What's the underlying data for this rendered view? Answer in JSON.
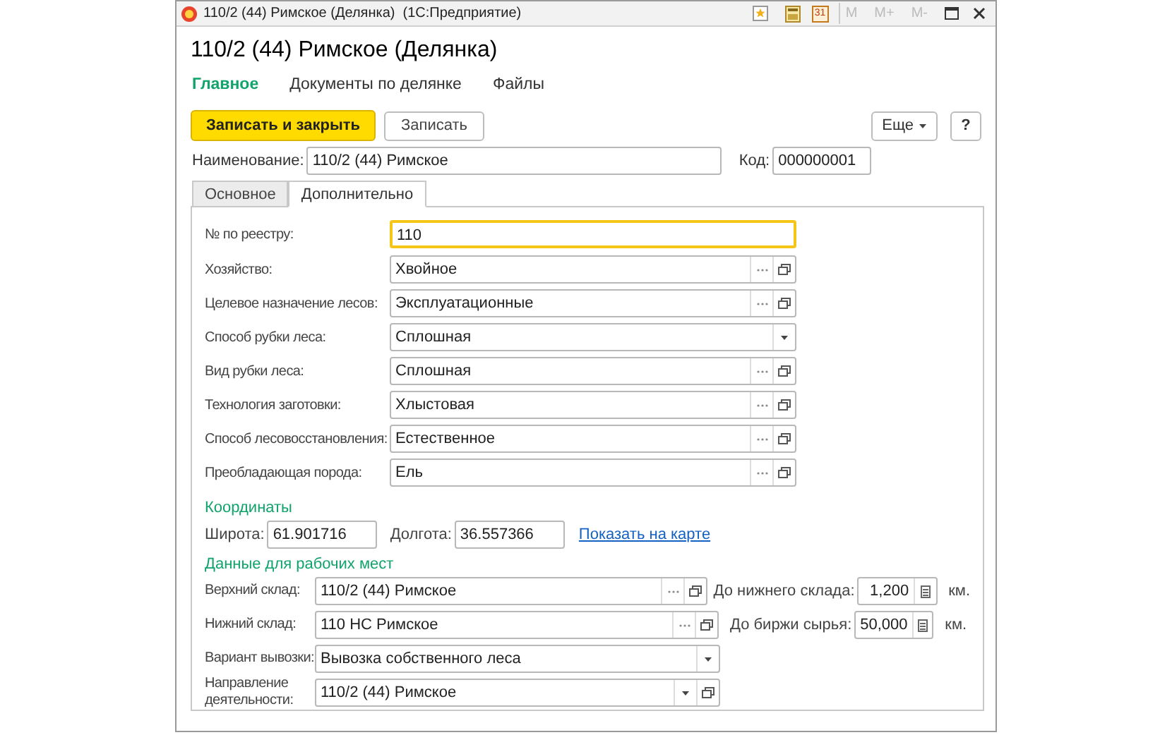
{
  "window": {
    "title": "110/2 (44) Римское (Делянка)  (1С:Предприятие)",
    "calendar_day": "31",
    "memory_buttons": [
      "M",
      "M+",
      "M-"
    ]
  },
  "header": {
    "title": "110/2 (44) Римское (Делянка)"
  },
  "nav": [
    {
      "label": "Главное",
      "selected": true
    },
    {
      "label": "Документы по делянке",
      "selected": false
    },
    {
      "label": "Файлы",
      "selected": false
    }
  ],
  "commands": {
    "primary": "Записать и закрыть",
    "secondary": "Записать",
    "more": "Еще",
    "help": "?"
  },
  "name_field": {
    "label": "Наименование:",
    "value": "110/2 (44) Римское"
  },
  "code_field": {
    "label": "Код:",
    "value": "000000001"
  },
  "tabs": [
    {
      "label": "Основное",
      "selected": false
    },
    {
      "label": "Дополнительно",
      "selected": true
    }
  ],
  "fields": [
    {
      "label": "№ по реестру:",
      "value": "110",
      "kind": "text",
      "focused": true
    },
    {
      "label": "Хозяйство:",
      "value": "Хвойное",
      "kind": "select",
      "focused": false
    },
    {
      "label": "Целевое назначение лесов:",
      "value": "Эксплуатационные",
      "kind": "select",
      "focused": false
    },
    {
      "label": "Способ рубки леса:",
      "value": "Сплошная",
      "kind": "dropdown",
      "focused": false
    },
    {
      "label": "Вид рубки леса:",
      "value": "Сплошная",
      "kind": "select",
      "focused": false
    },
    {
      "label": "Технология заготовки:",
      "value": "Хлыстовая",
      "kind": "select",
      "focused": false
    },
    {
      "label": "Способ лесовосстановления:",
      "value": "Естественное",
      "kind": "select",
      "focused": false
    },
    {
      "label": "Преобладающая порода:",
      "value": "Ель",
      "kind": "select",
      "focused": false
    }
  ],
  "coordinates": {
    "heading": "Координаты",
    "latitude": {
      "label": "Широта:",
      "value": "61.901716"
    },
    "longitude": {
      "label": "Долгота:",
      "value": "36.557366"
    },
    "map_link": "Показать на карте"
  },
  "workplace": {
    "heading": "Данные для рабочих мест",
    "fields": [
      {
        "label": "Верхний склад:",
        "value": "110/2 (44) Римское",
        "kind": "select",
        "distance": {
          "label": "До нижнего склада:",
          "value": "1,200",
          "unit": "км."
        }
      },
      {
        "label": "Нижний склад:",
        "value": "110 НС Римское",
        "kind": "select",
        "distance": {
          "label": "До биржи сырья:",
          "value": "50,000",
          "unit": "км."
        }
      },
      {
        "label": "Вариант вывозки:",
        "value": "Вывозка собственного леса",
        "kind": "dropdown"
      },
      {
        "label": "Направление деятельности:",
        "value": "110/2 (44) Римское",
        "kind": "dropdown_open"
      }
    ]
  }
}
